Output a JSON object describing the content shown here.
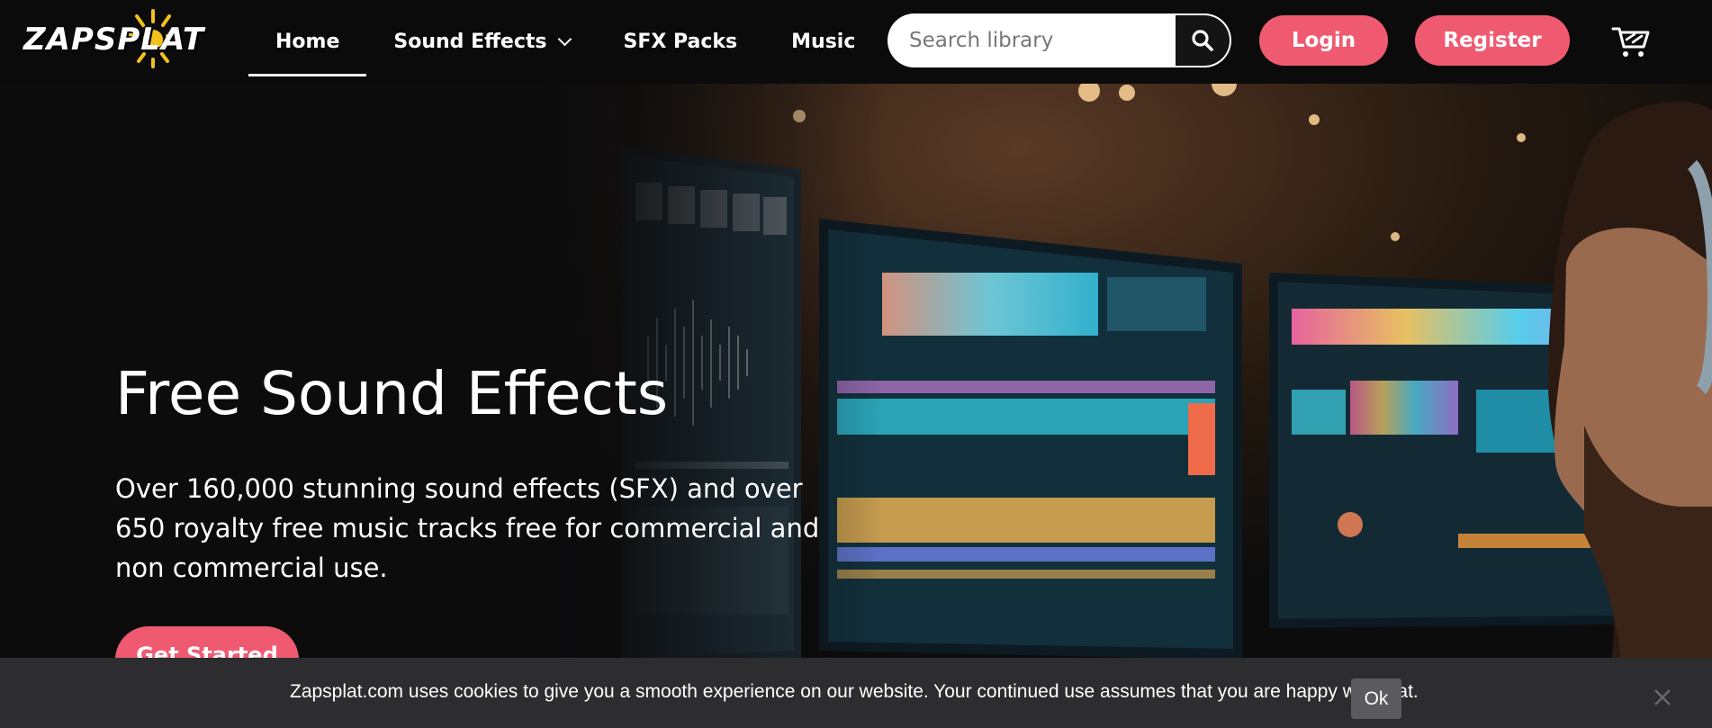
{
  "header": {
    "logo_text": "ZAPSPLAT",
    "nav": [
      {
        "label": "Home",
        "active": true
      },
      {
        "label": "Sound Effects",
        "has_dropdown": true
      },
      {
        "label": "SFX Packs"
      },
      {
        "label": "Music"
      }
    ],
    "search": {
      "placeholder": "Search library",
      "icon": "search-icon"
    },
    "login_label": "Login",
    "register_label": "Register",
    "cart_icon": "cart-icon"
  },
  "hero": {
    "title": "Free Sound Effects",
    "description": "Over 160,000 stunning sound effects (SFX) and over 650 royalty free music tracks free for commercial and non commercial use.",
    "cta_label": "Get Started"
  },
  "cookie_bar": {
    "message": "Zapsplat.com uses cookies to give you a smooth experience on our website. Your continued use assumes that you are happy with that.",
    "ok_label": "Ok",
    "close_icon": "close-icon"
  },
  "colors": {
    "accent": "#f05a71",
    "background": "#0b0b0c",
    "cookie_bg": "#2d2d30"
  }
}
